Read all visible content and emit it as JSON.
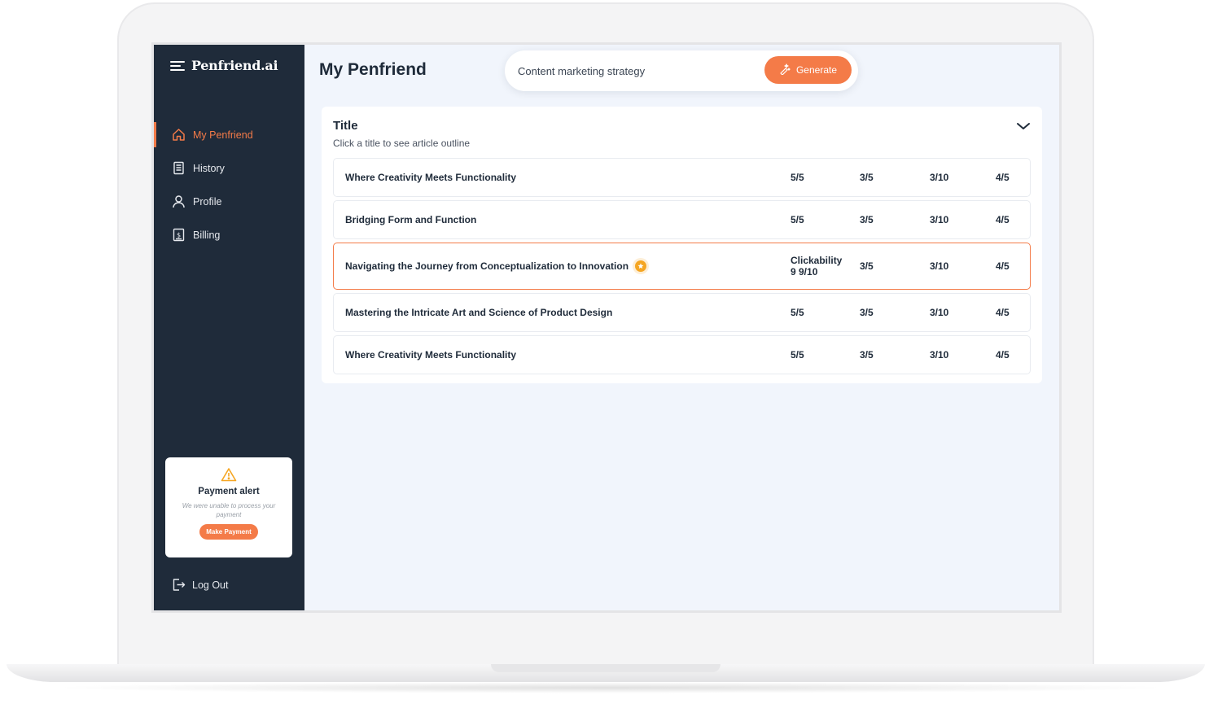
{
  "app": {
    "logo": "Penfriend.ai",
    "accent": "#f47b48",
    "sidebar_bg": "#1f2b3a"
  },
  "sidebar": {
    "items": [
      {
        "label": "My Penfriend",
        "icon": "home-icon",
        "active": true
      },
      {
        "label": "History",
        "icon": "document-list-icon",
        "active": false
      },
      {
        "label": "Profile",
        "icon": "user-icon",
        "active": false
      },
      {
        "label": "Billing",
        "icon": "billing-icon",
        "active": false
      }
    ],
    "alert": {
      "title": "Payment alert",
      "text": "We were unable to process your payment",
      "button": "Make Payment",
      "icon": "warning-icon"
    },
    "logout": "Log Out"
  },
  "header": {
    "title": "My Penfriend",
    "search_value": "Content marketing strategy",
    "generate_label": "Generate"
  },
  "panel": {
    "title": "Title",
    "subtitle": "Click a title to see article outline",
    "rows": [
      {
        "title": "Where Creativity Meets Functionality",
        "c1": "5/5",
        "c2": "3/5",
        "c3": "3/10",
        "c4": "4/5"
      },
      {
        "title": "Bridging Form and Function",
        "c1": "5/5",
        "c2": "3/5",
        "c3": "3/10",
        "c4": "4/5"
      },
      {
        "title": "Navigating the Journey from Conceptualization to Innovation",
        "c1": "Clickability 9 9/10",
        "c2": "3/5",
        "c3": "3/10",
        "c4": "4/5",
        "highlight": true
      },
      {
        "title": "Mastering the Intricate Art and Science of Product Design",
        "c1": "5/5",
        "c2": "3/5",
        "c3": "3/10",
        "c4": "4/5"
      },
      {
        "title": "Where Creativity Meets Functionality",
        "c1": "5/5",
        "c2": "3/5",
        "c3": "3/10",
        "c4": "4/5"
      }
    ]
  }
}
